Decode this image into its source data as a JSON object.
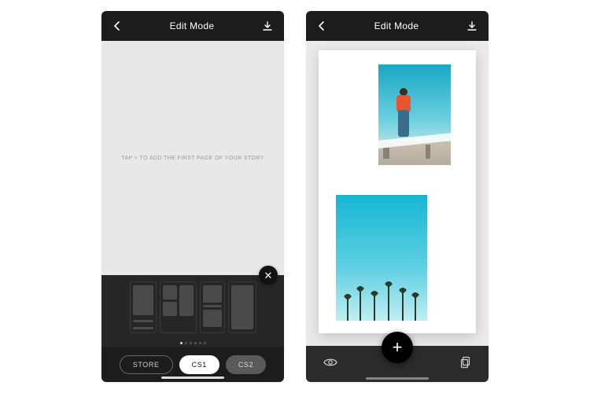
{
  "left": {
    "header": {
      "title": "Edit Mode"
    },
    "hint": "TAP + TO ADD THE FIRST PAGE OF YOUR STORY",
    "pills": {
      "store": "STORE",
      "cs1": "CS1",
      "cs2": "CS2"
    },
    "page_dots": {
      "count": 6,
      "active_index": 0
    }
  },
  "right": {
    "header": {
      "title": "Edit Mode"
    },
    "photos": {
      "top_alt": "person-on-rooftop",
      "bottom_alt": "palm-trees-sky"
    }
  }
}
